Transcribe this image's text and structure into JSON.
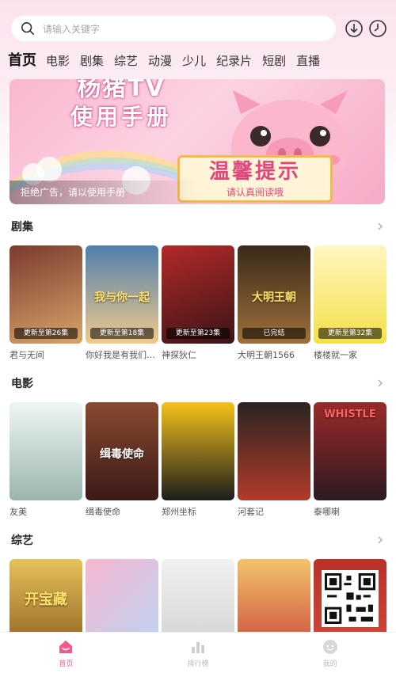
{
  "search": {
    "placeholder": "请输入关键字"
  },
  "top_icons": [
    "download-icon",
    "history-icon"
  ],
  "nav": {
    "tabs": [
      {
        "label": "首页",
        "active": true
      },
      {
        "label": "电影"
      },
      {
        "label": "剧集"
      },
      {
        "label": "综艺"
      },
      {
        "label": "动漫"
      },
      {
        "label": "少儿"
      },
      {
        "label": "纪录片"
      },
      {
        "label": "短剧"
      },
      {
        "label": "直播"
      }
    ]
  },
  "banner": {
    "line1": "杨猪TV",
    "line2": "使用手册",
    "sign_title": "温馨提示",
    "sign_sub": "请认真阅读哦",
    "caption": "拒绝广告，请以使用手册"
  },
  "sections": {
    "series": {
      "title": "剧集",
      "items": [
        {
          "name": "君与无间",
          "poster_text": "",
          "badge": "更新至第26集",
          "bg1": "#7a3b2e",
          "bg2": "#d9a46a"
        },
        {
          "name": "你好我是有我们一起...",
          "poster_text": "我与你一起",
          "badge": "更新至第18集",
          "bg1": "#f2c98a",
          "bg2": "#4f7fae"
        },
        {
          "name": "神探狄仁",
          "poster_text": "",
          "badge": "更新至第23集",
          "bg1": "#b32a2a",
          "bg2": "#3b1416"
        },
        {
          "name": "大明王朝1566",
          "poster_text": "大明王朝",
          "badge": "已完结",
          "bg1": "#3a2a1a",
          "bg2": "#a0703a"
        },
        {
          "name": "楼楼就一家",
          "poster_text": "",
          "badge": "更新至第32集",
          "bg1": "#f4e04a",
          "bg2": "#fff6c0"
        }
      ]
    },
    "movies": {
      "title": "电影",
      "items": [
        {
          "name": "友美",
          "poster_text": "",
          "badge": "",
          "bg1": "#d7e9e6",
          "bg2": "#9ab5ad"
        },
        {
          "name": "缉毒使命",
          "poster_text": "缉毒使命",
          "badge": "",
          "bg1": "#3b1a16",
          "bg2": "#8a4a30"
        },
        {
          "name": "郑州坐标",
          "poster_text": "",
          "badge": "",
          "bg1": "#f5c21a",
          "bg2": "#1d1d1d"
        },
        {
          "name": "河套记",
          "poster_text": "",
          "badge": "",
          "bg1": "#2a2422",
          "bg2": "#b23b2a"
        },
        {
          "name": "泰哪喇",
          "poster_text": "WHISTLE",
          "badge": "",
          "bg1": "#2d1a22",
          "bg2": "#9a2a2a"
        }
      ]
    },
    "variety": {
      "title": "综艺",
      "items": [
        {
          "name": "",
          "poster_text": "开宝藏",
          "bg1": "#8a5a1e",
          "bg2": "#e6c15a"
        },
        {
          "name": "",
          "poster_text": "",
          "bg1": "#f7b6d0",
          "bg2": "#b8d6f4"
        },
        {
          "name": "",
          "poster_text": "",
          "bg1": "#f1f1f1",
          "bg2": "#cfcfcf"
        },
        {
          "name": "",
          "poster_text": "",
          "bg1": "#c9453a",
          "bg2": "#f2c36a"
        },
        {
          "name": "",
          "poster_text": "",
          "bg1": "#b8322a",
          "bg2": "#d24a3a"
        }
      ]
    }
  },
  "bottom_nav": [
    {
      "label": "首页",
      "icon": "home-icon",
      "active": true
    },
    {
      "label": "排行榜",
      "icon": "ranking-icon"
    },
    {
      "label": "我的",
      "icon": "profile-icon"
    }
  ],
  "colors": {
    "accent": "#f05a8c",
    "top_bg": "#fbe3ee"
  }
}
